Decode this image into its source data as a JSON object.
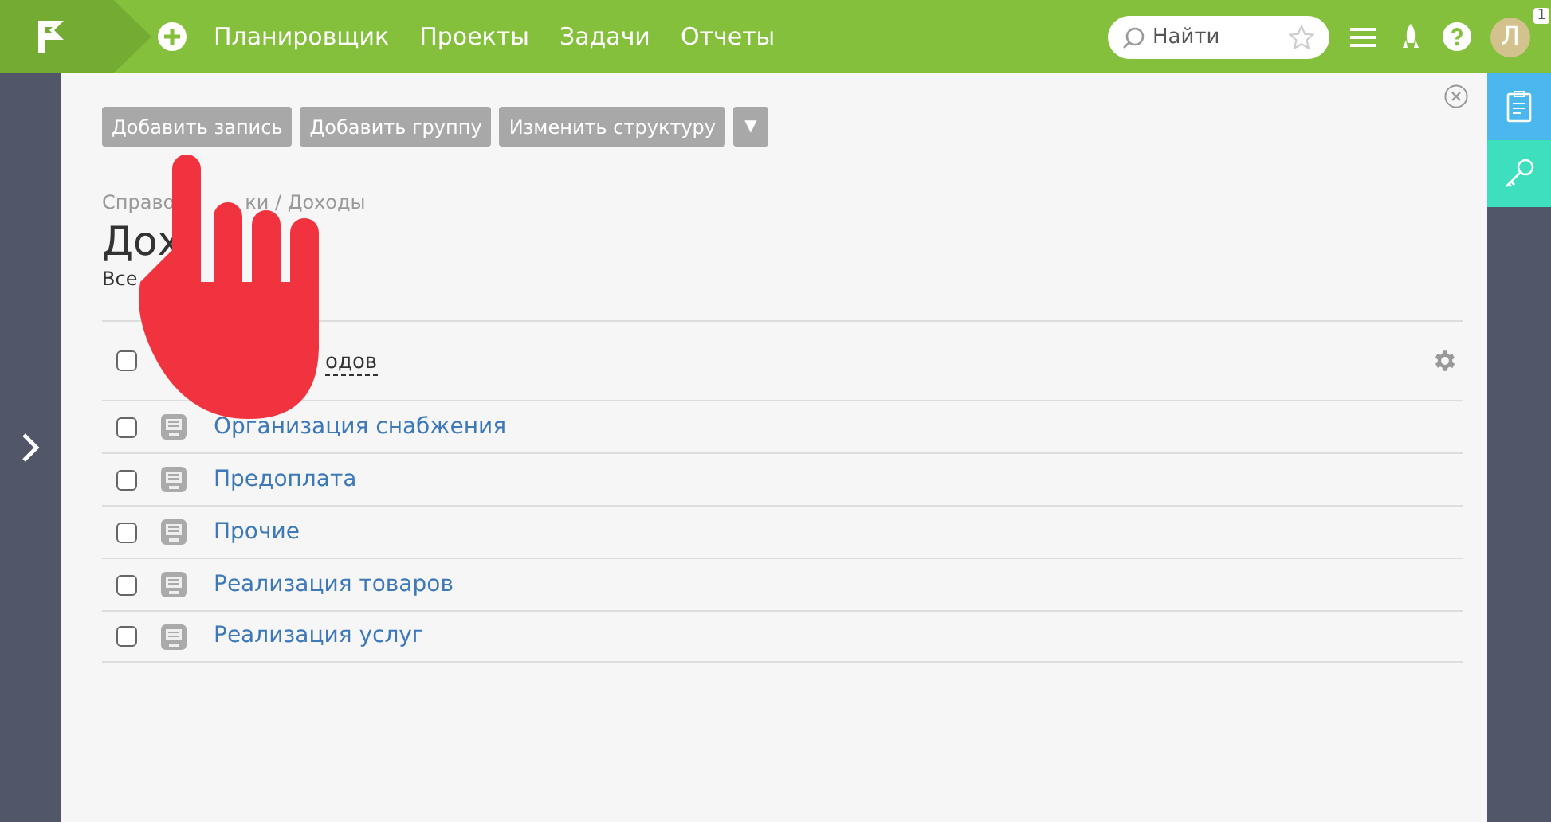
{
  "topbar": {
    "nav": [
      "Планировщик",
      "Проекты",
      "Задачи",
      "Отчеты"
    ],
    "search": {
      "placeholder": "Найти"
    },
    "avatar": "Л",
    "notifications": "1"
  },
  "toolbar": {
    "buttons": [
      "Добавить запись",
      "Добавить группу",
      "Изменить структуру"
    ],
    "menu": "▼"
  },
  "breadcrumb": [
    "Справо",
    "ки / Доходы"
  ],
  "title": "Дох",
  "subtitle": "Все",
  "table": {
    "header": "одов",
    "all_checked": false,
    "rows": [
      {
        "name": "Организация снабжения",
        "checked": false
      },
      {
        "name": "Предоплата",
        "checked": false
      },
      {
        "name": "Прочие",
        "checked": false
      },
      {
        "name": "Реализация товаров",
        "checked": false
      },
      {
        "name": "Реализация услуг",
        "checked": false
      }
    ]
  },
  "pointer": {
    "kind": "hand"
  }
}
